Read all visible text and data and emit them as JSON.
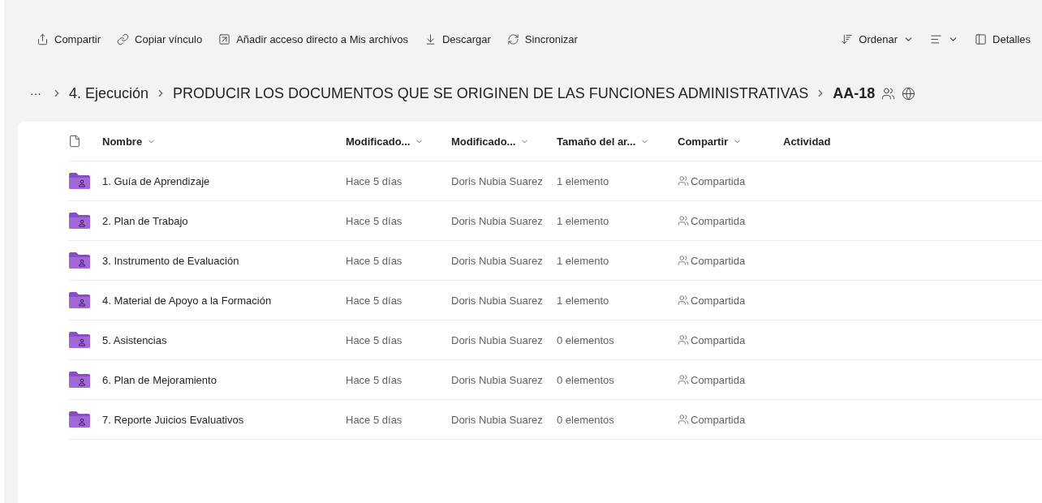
{
  "toolbar": {
    "actions": [
      {
        "kind": "share",
        "label": "Compartir"
      },
      {
        "kind": "link",
        "label": "Copiar vínculo"
      },
      {
        "kind": "shortcut",
        "label": "Añadir acceso directo a Mis archivos"
      },
      {
        "kind": "download",
        "label": "Descargar"
      },
      {
        "kind": "sync",
        "label": "Sincronizar"
      }
    ],
    "view_actions": [
      {
        "kind": "sort",
        "label": "Ordenar"
      },
      {
        "kind": "layout"
      },
      {
        "kind": "details",
        "label": "Detalles"
      }
    ]
  },
  "breadcrumb": {
    "more": "···",
    "items": [
      {
        "label": "4. Ejecución",
        "current": false
      },
      {
        "label": "PRODUCIR LOS DOCUMENTOS QUE SE ORIGINEN DE LAS FUNCIONES ADMINISTRATIVAS",
        "current": false
      },
      {
        "label": "AA-18",
        "current": true
      }
    ],
    "shared": true,
    "public": true
  },
  "table": {
    "columns": [
      {
        "label": "Nombre",
        "sortable": true
      },
      {
        "label": "Modificado...",
        "sortable": true
      },
      {
        "label": "Modificado...",
        "sortable": true
      },
      {
        "label": "Tamaño del ar...",
        "sortable": true
      },
      {
        "label": "Compartir",
        "sortable": true
      },
      {
        "label": "Actividad",
        "sortable": false
      }
    ],
    "rows": [
      {
        "name": "1. Guía de Aprendizaje",
        "modified": "Hace 5 días",
        "modified_by": "Doris Nubia Suarez",
        "size": "1 elemento",
        "sharing": "Compartida"
      },
      {
        "name": "2. Plan de Trabajo",
        "modified": "Hace 5 días",
        "modified_by": "Doris Nubia Suarez",
        "size": "1 elemento",
        "sharing": "Compartida"
      },
      {
        "name": "3. Instrumento de Evaluación",
        "modified": "Hace 5 días",
        "modified_by": "Doris Nubia Suarez",
        "size": "1 elemento",
        "sharing": "Compartida"
      },
      {
        "name": "4. Material de Apoyo a la Formación",
        "modified": "Hace 5 días",
        "modified_by": "Doris Nubia Suarez",
        "size": "1 elemento",
        "sharing": "Compartida"
      },
      {
        "name": "5. Asistencias",
        "modified": "Hace 5 días",
        "modified_by": "Doris Nubia Suarez",
        "size": "0 elementos",
        "sharing": "Compartida"
      },
      {
        "name": "6. Plan de Mejoramiento",
        "modified": "Hace 5 días",
        "modified_by": "Doris Nubia Suarez",
        "size": "0 elementos",
        "sharing": "Compartida"
      },
      {
        "name": "7. Reporte Juicios Evaluativos",
        "modified": "Hace 5 días",
        "modified_by": "Doris Nubia Suarez",
        "size": "0 elementos",
        "sharing": "Compartida"
      }
    ]
  }
}
